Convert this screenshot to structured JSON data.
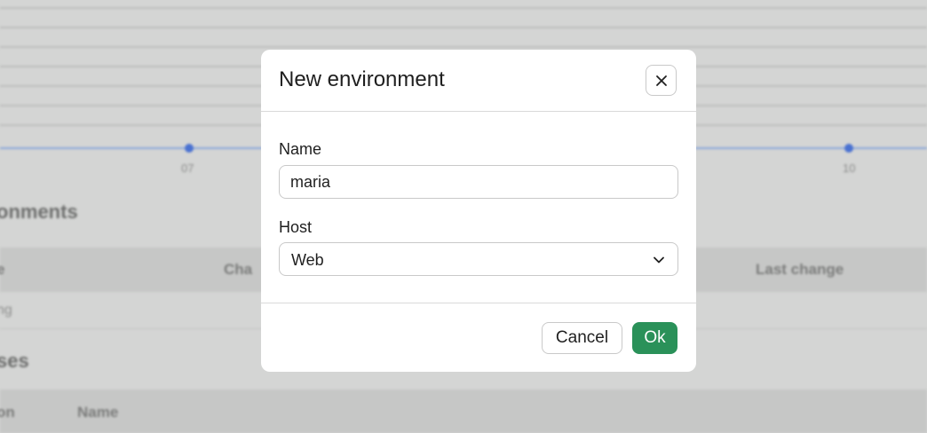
{
  "background": {
    "chart": {
      "tick_labels": [
        "07",
        "10"
      ]
    },
    "sections": [
      {
        "heading": "onments",
        "columns": [
          "e",
          "Cha",
          "Last change"
        ],
        "rows": [
          [
            "ng"
          ]
        ]
      },
      {
        "heading": "ses",
        "columns": [
          "on",
          "Name"
        ]
      }
    ]
  },
  "dialog": {
    "title": "New environment",
    "close_icon": "close-icon",
    "name_label": "Name",
    "name_value": "maria",
    "host_label": "Host",
    "host_value": "Web",
    "host_chevron_icon": "chevron-down-icon",
    "cancel_label": "Cancel",
    "ok_label": "Ok"
  },
  "colors": {
    "overlay": "#d4d5d4",
    "primary_button": "#2a9159",
    "series": "#4a72d1"
  }
}
